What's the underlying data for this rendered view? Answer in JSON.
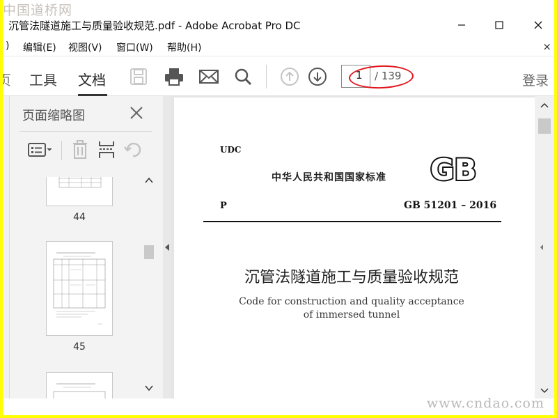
{
  "watermark_top": "中国道桥网",
  "window": {
    "title": "沉管法隧道施工与质量验收规范.pdf - Adobe Acrobat Pro DC",
    "minimize": "—",
    "maximize": "☐",
    "close": "✕"
  },
  "menu": {
    "partial": ")",
    "items": [
      "编辑(E)",
      "视图(V)",
      "窗口(W)",
      "帮助(H)"
    ],
    "close": "×"
  },
  "toolbar": {
    "partial_tab": "页",
    "tabs": [
      "工具",
      "文档"
    ],
    "active_tab": "文档",
    "page_current": "1",
    "page_total": "/ 139",
    "signin": "登录"
  },
  "panel": {
    "title": "页面缩略图",
    "thumbnails": [
      {
        "label": "44"
      },
      {
        "label": "45"
      },
      {
        "label": ""
      }
    ]
  },
  "document": {
    "udc": "UDC",
    "national_standard": "中华人民共和国国家标准",
    "gb_logo": "GB",
    "p_code": "P",
    "standard_number": "GB 51201 – 2016",
    "title_cn": "沉管法隧道施工与质量验收规范",
    "title_en_line1": "Code for construction and quality acceptance",
    "title_en_line2": "of immersed tunnel"
  },
  "watermark_bottom": "www.cndao.com",
  "colors": {
    "highlight_ellipse": "#e1141b",
    "border": "#ffff00"
  }
}
